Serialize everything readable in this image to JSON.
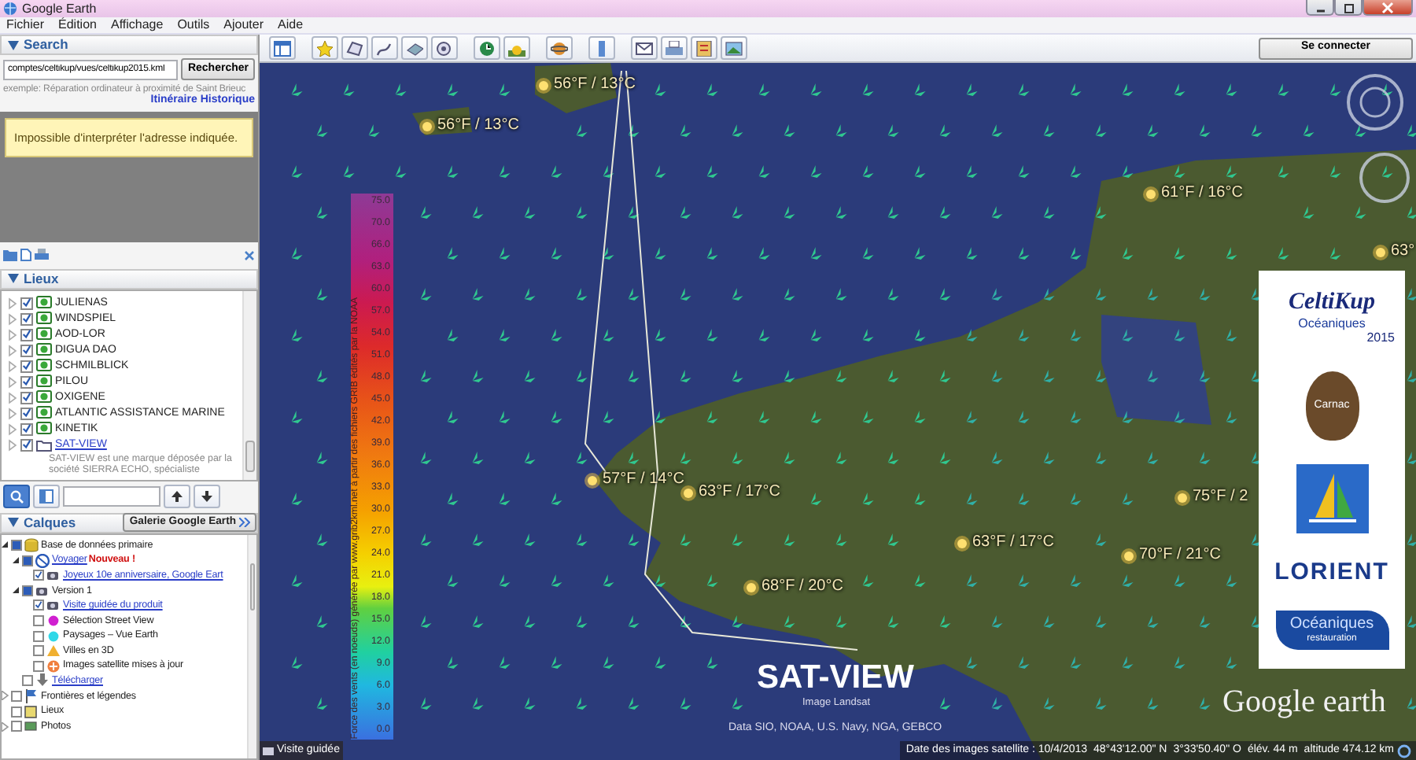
{
  "window": {
    "title": "Google Earth"
  },
  "menu": [
    "Fichier",
    "Édition",
    "Affichage",
    "Outils",
    "Ajouter",
    "Aide"
  ],
  "search": {
    "title": "Search",
    "value": "comptes/celtikup/vues/celtikup2015.kml",
    "button": "Rechercher",
    "example": "exemple: Réparation ordinateur à proximité de Saint Brieuc",
    "links": [
      "Itinéraire",
      "Historique"
    ],
    "message": "Impossible d'interpréter l'adresse indiquée."
  },
  "places": {
    "title": "Lieux",
    "items": [
      {
        "label": "JULIENAS",
        "checked": true,
        "kind": "placemark"
      },
      {
        "label": "WINDSPIEL",
        "checked": true,
        "kind": "placemark"
      },
      {
        "label": "AOD-LOR",
        "checked": true,
        "kind": "placemark"
      },
      {
        "label": "DIGUA DAO",
        "checked": true,
        "kind": "placemark"
      },
      {
        "label": "SCHMILBLICK",
        "checked": true,
        "kind": "placemark"
      },
      {
        "label": "PILOU",
        "checked": true,
        "kind": "placemark"
      },
      {
        "label": "OXIGENE",
        "checked": true,
        "kind": "placemark"
      },
      {
        "label": "ATLANTIC ASSISTANCE MARINE",
        "checked": true,
        "kind": "placemark"
      },
      {
        "label": "KINETIK",
        "checked": true,
        "kind": "placemark"
      },
      {
        "label": "SAT-VIEW",
        "checked": true,
        "kind": "folder",
        "description": "SAT-VIEW est une marque déposée par la société SIERRA ECHO, spécialiste"
      }
    ]
  },
  "layers": {
    "title": "Calques",
    "gallery": "Galerie Google Earth",
    "tree": [
      {
        "label": "Base de données primaire",
        "kind": "database",
        "checked": true,
        "partial": true,
        "children": [
          {
            "label": "Voyager",
            "kind": "voyager",
            "checked": true,
            "partial": true,
            "link": true,
            "badge": "Nouveau !",
            "children": [
              {
                "label": "Joyeux 10e anniversaire, Google Eart",
                "kind": "tour",
                "checked": true,
                "link": true
              }
            ]
          },
          {
            "label": "Version 1",
            "kind": "tour",
            "checked": true,
            "partial": true,
            "children": [
              {
                "label": "Visite guidée du produit",
                "kind": "tour",
                "checked": true,
                "link": true
              },
              {
                "label": "Sélection Street View",
                "kind": "dot",
                "color": "#d020d0",
                "checked": false
              },
              {
                "label": "Paysages – Vue Earth",
                "kind": "dot",
                "color": "#30d8e8",
                "checked": false
              },
              {
                "label": "Villes en 3D",
                "kind": "triangle",
                "color": "#f0b030",
                "checked": false
              },
              {
                "label": "Images satellite mises à jour",
                "kind": "plus",
                "color": "#f08040",
                "checked": false
              }
            ]
          },
          {
            "label": "Télécharger",
            "kind": "download",
            "checked": false,
            "link": true
          }
        ]
      },
      {
        "label": "Frontières et légendes",
        "kind": "flag",
        "checked": false,
        "expandable": true
      },
      {
        "label": "Lieux",
        "kind": "places",
        "checked": false
      },
      {
        "label": "Photos",
        "kind": "photos",
        "checked": false,
        "expandable": true
      }
    ]
  },
  "toolbar": {
    "sign_in": "Se connecter"
  },
  "map": {
    "temperatures": [
      "56°F / 13°C",
      "56°F / 13°C",
      "61°F / 16°C",
      "63°",
      "57°F / 14°C",
      "63°F / 17°C",
      "75°F / 2",
      "63°F / 17°C",
      "70°F / 21°C",
      "68°F / 20°C"
    ],
    "legend": {
      "caption": "Force des vents (en noeuds) générée par www.grib2kml.net à partir des fichiers GRIB édités par la NOAA",
      "values": [
        "75.0",
        "70.0",
        "66.0",
        "63.0",
        "60.0",
        "57.0",
        "54.0",
        "51.0",
        "48.0",
        "45.0",
        "42.0",
        "39.0",
        "36.0",
        "33.0",
        "30.0",
        "27.0",
        "24.0",
        "21.0",
        "18.0",
        "15.0",
        "12.0",
        "9.0",
        "6.0",
        "3.0",
        "0.0"
      ]
    },
    "sponsors": [
      {
        "kind": "celtikup",
        "texts": [
          "CeltiKup",
          "Océaniques",
          "2015"
        ]
      },
      {
        "kind": "carnac",
        "texts": [
          "Carnac"
        ]
      },
      {
        "kind": "emblem"
      },
      {
        "kind": "lorient",
        "texts": [
          "LORIENT"
        ]
      },
      {
        "kind": "oceaniques",
        "texts": [
          "Océaniques",
          "restauration"
        ]
      }
    ],
    "brand": "SAT-VIEW",
    "image_credit": "Image Landsat",
    "data_credit": "Data SIO, NOAA, U.S. Navy, NGA, GEBCO",
    "logo": "Google earth"
  },
  "status": {
    "tour": "Visite guidée",
    "date": "Date des images satellite : 10/4/2013",
    "lat": "48°43'12.00\" N",
    "lon": "3°33'50.40\" O",
    "elev_label": "élév.",
    "elev": "44 m",
    "altitude": "altitude 474.12 km"
  }
}
